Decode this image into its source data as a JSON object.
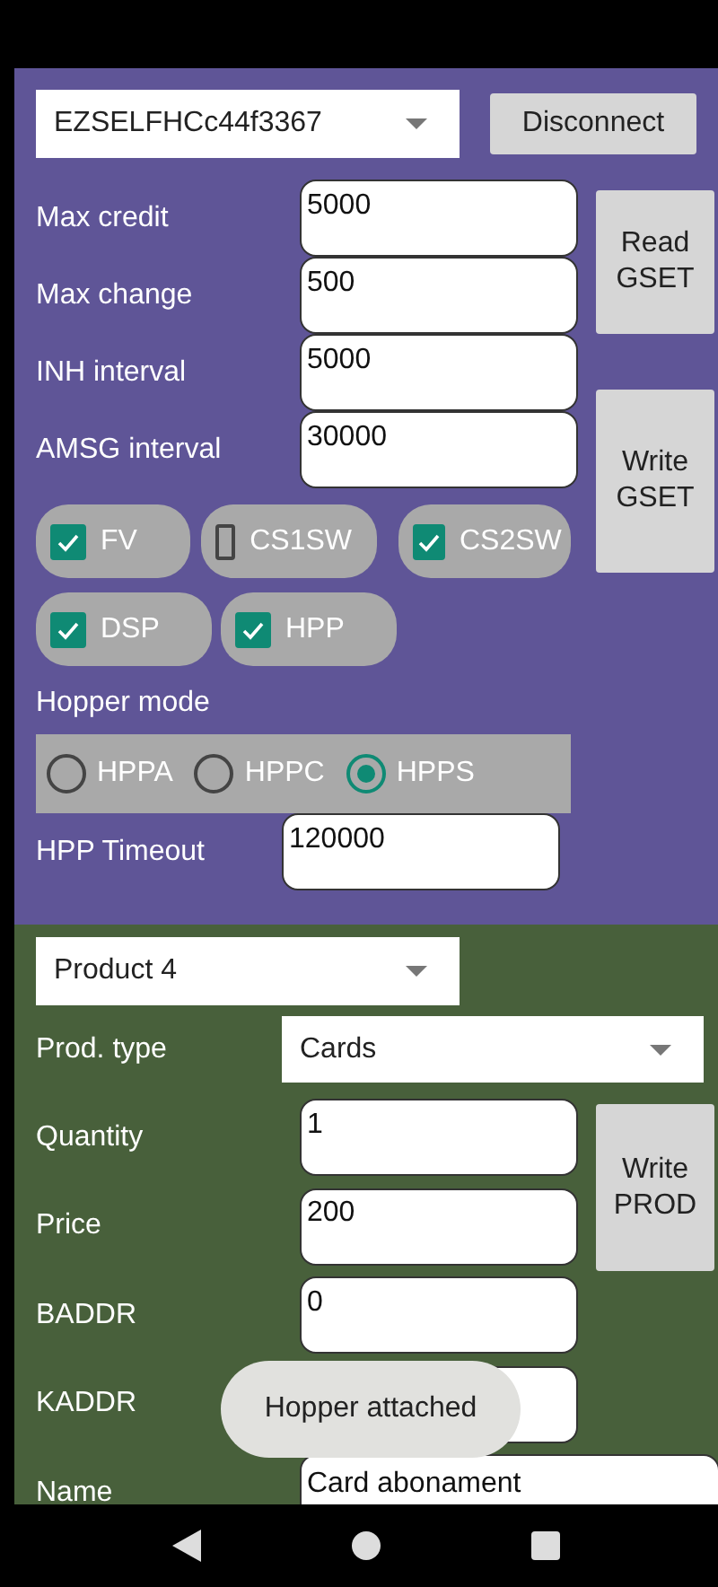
{
  "device_spinner": {
    "value": "EZSELFHCc44f3367"
  },
  "disconnect_button": "Disconnect",
  "settings": [
    {
      "label": "Max credit",
      "value": "5000"
    },
    {
      "label": "Max change",
      "value": "500"
    },
    {
      "label": "INH interval",
      "value": "5000"
    },
    {
      "label": "AMSG interval",
      "value": "30000"
    }
  ],
  "read_button": "Read GSET",
  "write_button": "Write GSET",
  "options": [
    {
      "label": "FV",
      "checked": true
    },
    {
      "label": "CS1SW",
      "checked": false
    },
    {
      "label": "CS2SW",
      "checked": true
    },
    {
      "label": "DSP",
      "checked": true
    },
    {
      "label": "HPP",
      "checked": true
    }
  ],
  "hopper_mode": {
    "label": "Hopper mode",
    "options": [
      {
        "label": "HPPA",
        "selected": false
      },
      {
        "label": "HPPC",
        "selected": false
      },
      {
        "label": "HPPS",
        "selected": true
      }
    ]
  },
  "hpp_timeout": {
    "label": "HPP Timeout",
    "value": "120000"
  },
  "product_spinner": {
    "value": "Product 4"
  },
  "prod_type": {
    "label": "Prod. type",
    "value": "Cards"
  },
  "product_fields": [
    {
      "label": "Quantity",
      "value": "1"
    },
    {
      "label": "Price",
      "value": "200"
    },
    {
      "label": "BADDR",
      "value": "0"
    },
    {
      "label": "KADDR"
    },
    {
      "label": "Name",
      "value": "Card abonament"
    }
  ],
  "write_prod_button": "Write PROD",
  "toast": "Hopper attached"
}
